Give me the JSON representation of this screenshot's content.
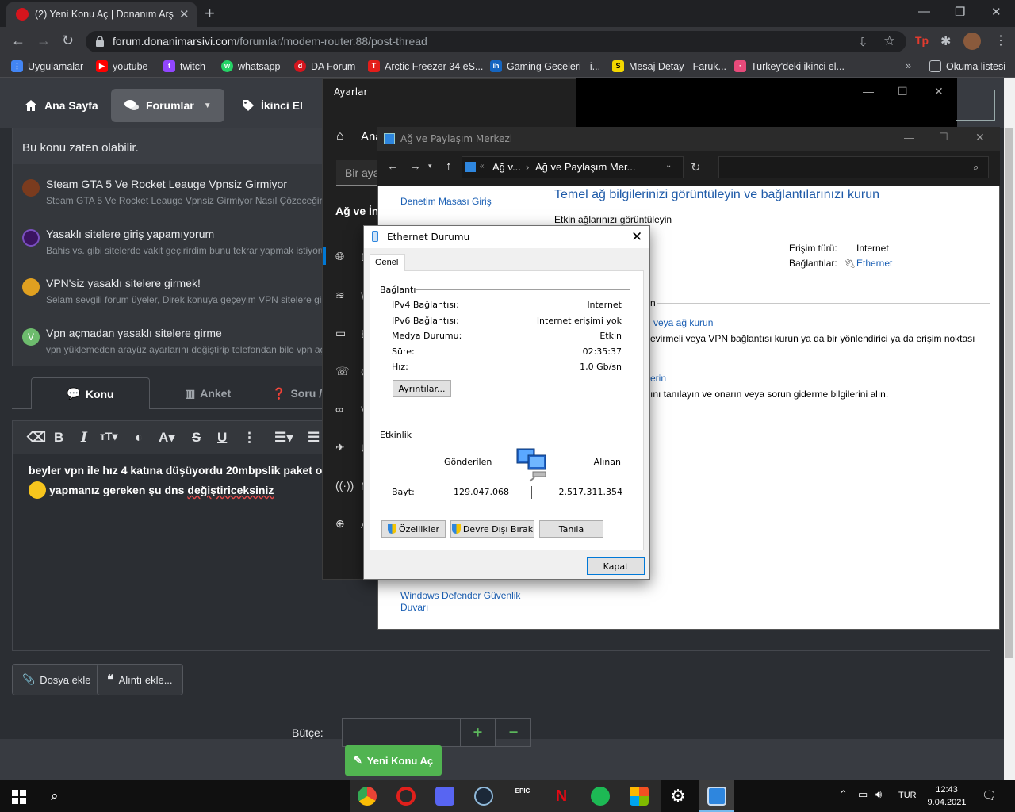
{
  "chrome": {
    "tab_title": "(2) Yeni Konu Aç | Donanım Arşivi Forum",
    "url_domain": "forum.donanimarsivi.com",
    "url_path": "/forumlar/modem-router.88/post-thread",
    "bookmarks": [
      {
        "label": "Uygulamalar",
        "icon": "apps-grid-icon",
        "color": "#4285f4"
      },
      {
        "label": "youtube",
        "icon": "youtube-icon",
        "color": "#ff0000"
      },
      {
        "label": "twitch",
        "icon": "twitch-icon",
        "color": "#9146ff"
      },
      {
        "label": "whatsapp",
        "icon": "whatsapp-icon",
        "color": "#25d366"
      },
      {
        "label": "DA Forum",
        "icon": "da-forum-icon",
        "color": "#d4151d"
      },
      {
        "label": "Arctic Freezer 34 eS...",
        "icon": "technopat-icon",
        "color": "#e31d1a"
      },
      {
        "label": "Gaming Geceleri - i...",
        "icon": "ih-icon",
        "color": "#1565c0"
      },
      {
        "label": "Mesaj Detay - Faruk...",
        "icon": "s-icon",
        "color": "#f2d600"
      },
      {
        "label": "Turkey'deki ikinci el...",
        "icon": "pink-icon",
        "color": "#e84a7a"
      }
    ],
    "reading_list": "Okuma listesi"
  },
  "forum": {
    "nav": [
      {
        "label": "Ana Sayfa",
        "icon": "home-icon"
      },
      {
        "label": "Forumlar",
        "icon": "chat-icon"
      },
      {
        "label": "İkinci El",
        "icon": "tag-icon"
      }
    ],
    "similar_title": "Bu konu zaten olabilir.",
    "similar_threads": [
      {
        "title": "Steam GTA 5 Ve Rocket Leauge Vpnsiz Girmiyor",
        "snippet": "Steam GTA 5 Ve Rocket Leauge Vpnsiz Girmiyor Nasıl Çözeceğim Sorunu",
        "avatar_color": "#7a3b1e"
      },
      {
        "title": "Yasaklı sitelere giriş yapamıyorum",
        "snippet": "Bahis vs. gibi sitelerde vakit geçirirdim bunu tekrar yapmak istiyorum",
        "avatar_color": "#3b1460"
      },
      {
        "title": "VPN'siz yasaklı sitelere girmek!",
        "snippet": "Selam sevgili forum üyeler, Direk konuya geçeyim VPN sitelere giremiyorum",
        "avatar_color": "#e0a020"
      },
      {
        "title": "Vpn açmadan yasaklı sitelere girme",
        "snippet": "vpn yüklemeden arayüz ayarlarını değiştirip telefondan bile vpn açmadan",
        "avatar_color": "#6dbb6d"
      }
    ],
    "tabs": [
      "Konu",
      "Anket",
      "Soru /"
    ],
    "editor_line1": "beyler vpn ile hız 4 katına düşüyordu 20mbpslik paket oluyor",
    "editor_line2a": "yapmanız gereken şu dns",
    "editor_line2b": "değiştiriceksiniz",
    "attach_button": "Dosya ekle",
    "quote_button": "Alıntı ekle...",
    "budget_label": "Bütçe:",
    "plus": "+",
    "minus": "−",
    "submit": "Yeni Konu Aç"
  },
  "settings": {
    "title": "Ayarlar",
    "home_label": "Ana",
    "search_placeholder": "Bir aya",
    "group_label": "Ağ ve İn",
    "items": [
      "D",
      "W",
      "E",
      "Ç",
      "V",
      "U",
      "M",
      "A"
    ]
  },
  "network_center": {
    "title": "Ağ ve Paylaşım Merkezi",
    "breadcrumb_1": "Ağ v...",
    "breadcrumb_2": "Ağ ve Paylaşım Mer...",
    "left_link": "Denetim Masası Giriş",
    "heading": "Temel ağ bilgilerinizi görüntüleyin ve bağlantılarınızı kurun",
    "active_networks": "Etkin ağlarınızı görüntüleyin",
    "access_type_label": "Erişim türü:",
    "access_type_value": "Internet",
    "connections_label": "Bağlantılar:",
    "connections_value": "Ethernet",
    "change_section": "n",
    "setup_link": "veya ağ kurun",
    "setup_desc": "evirmeli veya VPN bağlantısı kurun ya da bir yönlendirici ya da erişim noktası",
    "troubleshoot_link": "erin",
    "troubleshoot_desc": "ını tanılayın ve onarın veya sorun giderme bilgilerini alın.",
    "firewall_link_1": "Windows Defender Güvenlik",
    "firewall_link_2": "Duvarı"
  },
  "ethernet_dialog": {
    "title": "Ethernet Durumu",
    "tab": "Genel",
    "section_connection": "Bağlantı",
    "rows": [
      {
        "label": "IPv4 Bağlantısı:",
        "value": "Internet"
      },
      {
        "label": "IPv6 Bağlantısı:",
        "value": "Internet erişimi yok"
      },
      {
        "label": "Medya Durumu:",
        "value": "Etkin"
      },
      {
        "label": "Süre:",
        "value": "02:35:37"
      },
      {
        "label": "Hız:",
        "value": "1,0 Gb/sn"
      }
    ],
    "details_button": "Ayrıntılar...",
    "section_activity": "Etkinlik",
    "sent_label": "Gönderilen",
    "received_label": "Alınan",
    "bytes_label": "Bayt:",
    "bytes_sent": "129.047.068",
    "bytes_received": "2.517.311.354",
    "properties_button": "Özellikler",
    "disable_button": "Devre Dışı Bırak",
    "diagnose_button": "Tanıla",
    "close_button": "Kapat"
  },
  "taskbar": {
    "apps": [
      {
        "icon": "chrome-icon",
        "color": "#4caf50"
      },
      {
        "icon": "opera-icon",
        "color": "#e0201c"
      },
      {
        "icon": "discord-icon",
        "color": "#5865f2"
      },
      {
        "icon": "steam-icon",
        "color": "#1b2838"
      },
      {
        "icon": "epic-games-icon",
        "color": "#2a2a2a"
      },
      {
        "icon": "netflix-icon",
        "color": "#e50914"
      },
      {
        "icon": "spotify-icon",
        "color": "#1db954"
      },
      {
        "icon": "store-icon",
        "color": "#f3f3f3"
      },
      {
        "icon": "settings-icon",
        "color": "#dddddd"
      },
      {
        "icon": "control-panel-icon",
        "color": "#2e86de"
      }
    ],
    "lang": "TUR",
    "time": "12:43",
    "date": "9.04.2021"
  }
}
